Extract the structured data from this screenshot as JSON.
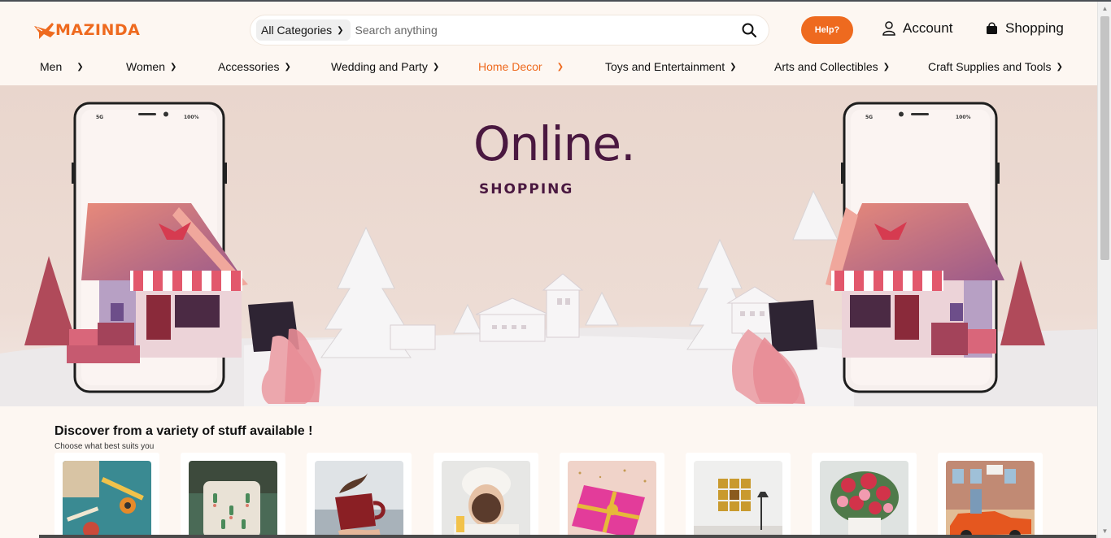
{
  "brand": {
    "logo_text": "MAZINDA",
    "accent_color": "#ee6a1f"
  },
  "search": {
    "category": "All Categories",
    "placeholder": "Search anything"
  },
  "header": {
    "help_label": "Help?",
    "account_label": "Account",
    "shopping_label": "Shopping"
  },
  "nav": {
    "items": [
      {
        "label": "Men"
      },
      {
        "label": "Women"
      },
      {
        "label": "Accessories"
      },
      {
        "label": "Wedding and Party"
      },
      {
        "label": "Home Decor",
        "active": true
      },
      {
        "label": "Toys and Entertainment"
      },
      {
        "label": "Arts and Collectibles"
      },
      {
        "label": "Craft Supplies and Tools"
      }
    ]
  },
  "hero": {
    "title": "Online.",
    "subtitle": "SHOPPING",
    "phone_status": "5G",
    "phone_battery": "100%"
  },
  "discover": {
    "title": "Discover from a variety of stuff available !",
    "subtitle": "Choose what best suits you"
  },
  "products": [
    {
      "icon": "craft-tools-image"
    },
    {
      "icon": "cactus-pillow-image"
    },
    {
      "icon": "coffee-mug-image"
    },
    {
      "icon": "face-mask-woman-image"
    },
    {
      "icon": "gift-box-image"
    },
    {
      "icon": "wall-art-image"
    },
    {
      "icon": "flower-bouquet-image"
    },
    {
      "icon": "vintage-car-image"
    }
  ]
}
